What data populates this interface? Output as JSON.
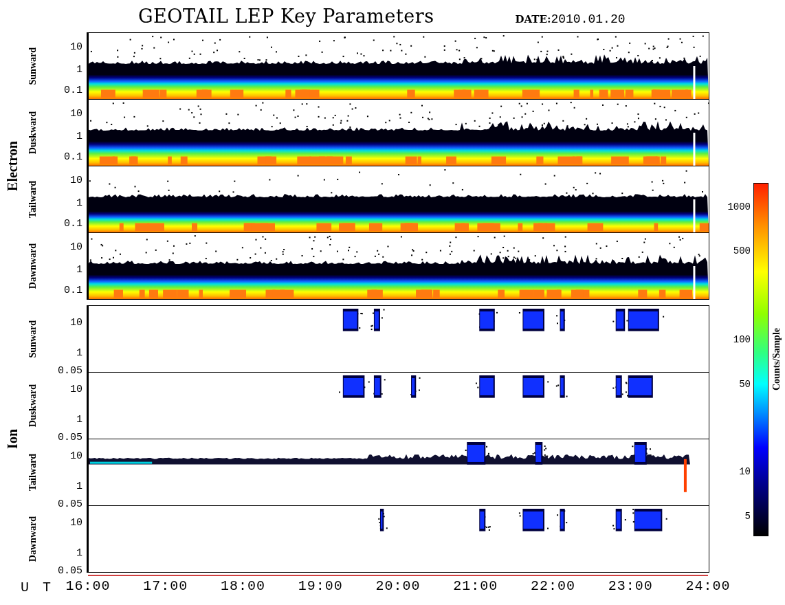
{
  "title": "GEOTAIL LEP Key Parameters",
  "date": {
    "label": "DATE:",
    "value": "2010.01.20"
  },
  "groups": [
    {
      "name": "Electron",
      "kind": "electron",
      "panels": [
        {
          "direction": "Sunward",
          "yticks": [
            "10",
            "1",
            "0.1"
          ]
        },
        {
          "direction": "Duskward",
          "yticks": [
            "10",
            "1",
            "0.1"
          ]
        },
        {
          "direction": "Tailward",
          "yticks": [
            "10",
            "1",
            "0.1"
          ]
        },
        {
          "direction": "Dawnward",
          "yticks": [
            "10",
            "1",
            "0.1"
          ]
        }
      ]
    },
    {
      "name": "Ion",
      "kind": "ion",
      "panels": [
        {
          "direction": "Sunward",
          "yticks": [
            "10",
            "1",
            "0.05"
          ]
        },
        {
          "direction": "Duskward",
          "yticks": [
            "10",
            "1",
            "0.05"
          ]
        },
        {
          "direction": "Tailward",
          "yticks": [
            "10",
            "1",
            "0.05"
          ]
        },
        {
          "direction": "Dawnward",
          "yticks": [
            "10",
            "1",
            "0.05"
          ]
        }
      ]
    }
  ],
  "colorbar": {
    "label": "Counts/Sample",
    "ticks": [
      "1000",
      "500",
      "100",
      "50",
      "10",
      "5"
    ]
  },
  "xaxis": {
    "label": "U T",
    "ticks": [
      "16:00",
      "17:00",
      "18:00",
      "19:00",
      "20:00",
      "21:00",
      "22:00",
      "23:00",
      "24:00"
    ]
  }
}
